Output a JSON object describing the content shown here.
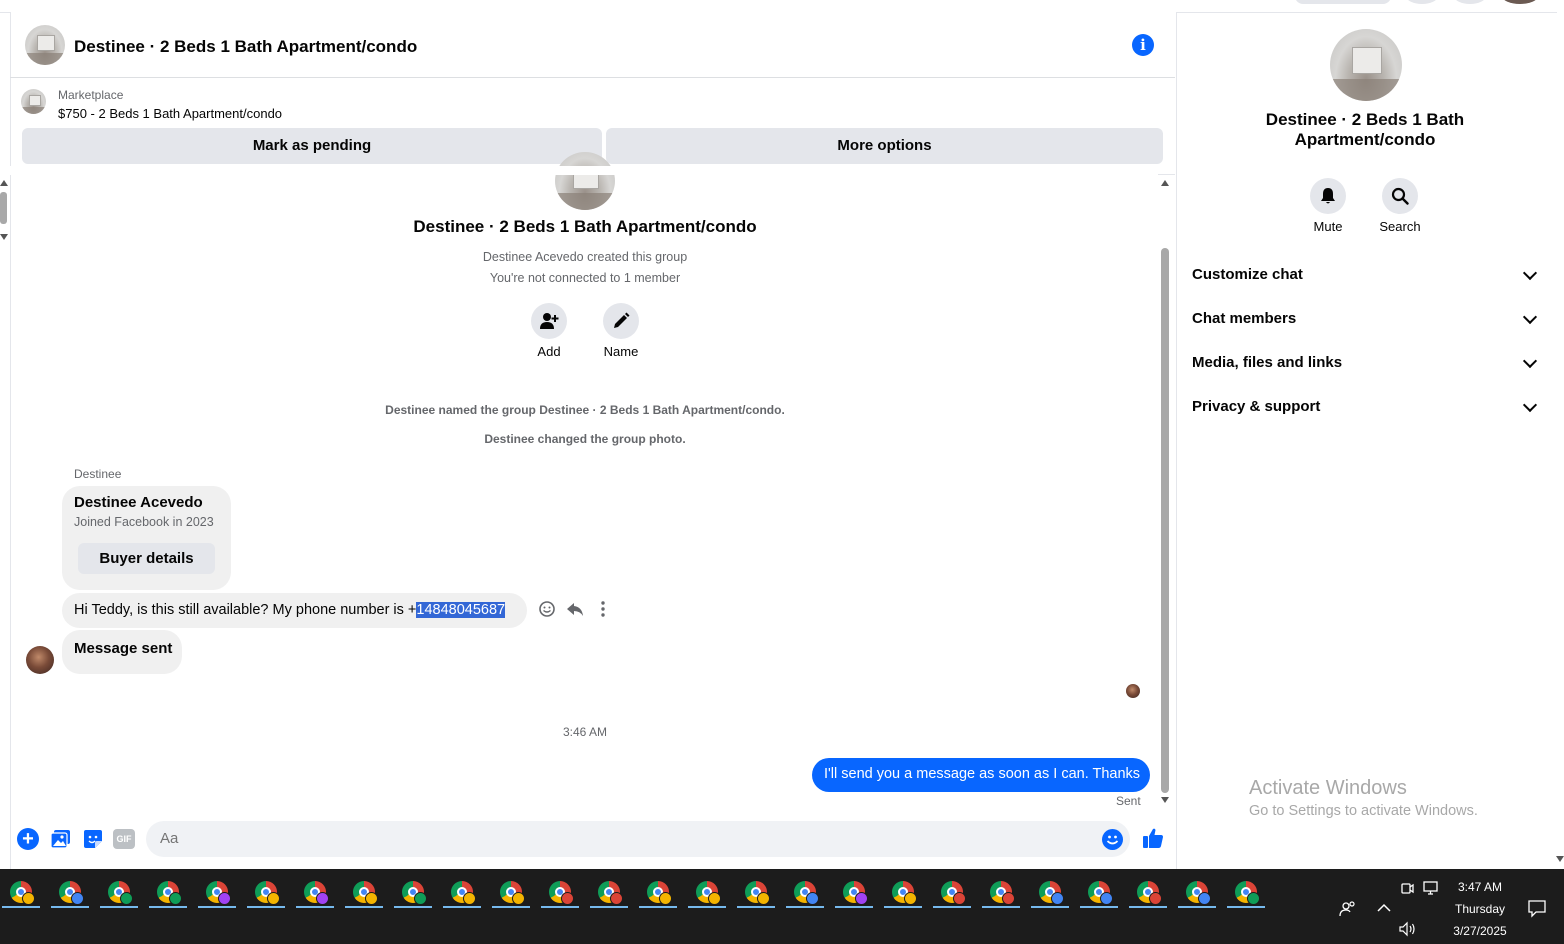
{
  "header": {
    "title": "Destinee · 2 Beds 1 Bath Apartment/condo",
    "info_icon": "info-icon"
  },
  "marketplace": {
    "label": "Marketplace",
    "listing": "$750 - 2 Beds 1 Bath Apartment/condo",
    "mark_pending": "Mark as pending",
    "more_options": "More options"
  },
  "conversation": {
    "group_title": "Destinee · 2 Beds 1 Bath Apartment/condo",
    "created_by": "Destinee Acevedo created this group",
    "not_connected": "You're not connected to 1 member",
    "add_label": "Add",
    "name_label": "Name",
    "system_1": "Destinee named the group Destinee · 2 Beds 1 Bath Apartment/condo.",
    "system_2": "Destinee changed the group photo.",
    "sender_name": "Destinee",
    "card_name": "Destinee Acevedo",
    "card_joined": "Joined Facebook in 2023",
    "buyer_details": "Buyer details",
    "msg1_prefix": "Hi Teddy, is this still available? My phone number is +",
    "msg1_highlight": "14848045687",
    "msg2": "Message sent",
    "timestamp": "3:46 AM",
    "outgoing": "I'll send you a message as soon as I can. Thanks",
    "status": "Sent"
  },
  "composer": {
    "placeholder": "Aa"
  },
  "right_panel": {
    "name_line1": "Destinee · 2 Beds 1 Bath",
    "name_line2": "Apartment/condo",
    "mute_label": "Mute",
    "search_label": "Search",
    "sections": [
      "Customize chat",
      "Chat members",
      "Media, files and links",
      "Privacy & support"
    ]
  },
  "watermark": {
    "line1": "Activate Windows",
    "line2": "Go to Settings to activate Windows."
  },
  "taskbar": {
    "time": "3:47 AM",
    "day": "Thursday",
    "date": "3/27/2025",
    "app_badge_colors": [
      "#f4b400",
      "#4285f4",
      "#0f9d58",
      "#0f9d58",
      "#a142f4",
      "#f4b400",
      "#a142f4",
      "#f4b400",
      "#0f9d58",
      "#f4b400",
      "#f4b400",
      "#db4437",
      "#db4437",
      "#f4b400",
      "#f4b400",
      "#f4b400",
      "#4285f4",
      "#a142f4",
      "#f4b400",
      "#db4437",
      "#db4437",
      "#4285f4",
      "#4285f4",
      "#db4437",
      "#4285f4",
      "#0f9d58"
    ]
  },
  "colors": {
    "accent": "#0866ff",
    "bubble_grey": "#f0f0f0",
    "taskbar": "#1c1c1c"
  }
}
